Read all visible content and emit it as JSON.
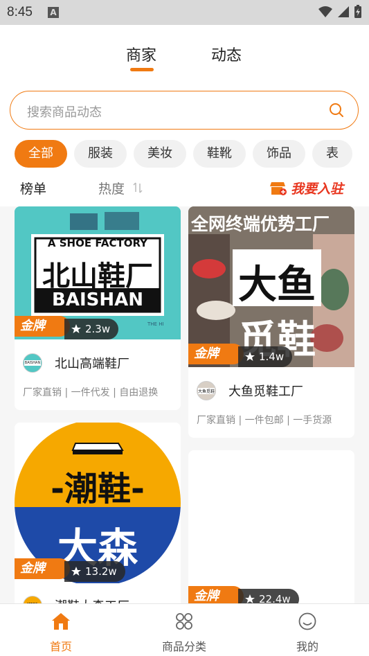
{
  "status": {
    "time": "8:45",
    "notif_icon": "A"
  },
  "tabs": [
    {
      "label": "商家",
      "active": true
    },
    {
      "label": "动态",
      "active": false
    }
  ],
  "search": {
    "placeholder": "搜索商品动态"
  },
  "categories": [
    "全部",
    "服装",
    "美妆",
    "鞋靴",
    "饰品",
    "表"
  ],
  "sort": {
    "rank_label": "榜单",
    "hot_label": "热度",
    "join_label": "我要入驻"
  },
  "cards": [
    {
      "badge": "金牌",
      "heat": "2.3w",
      "name": "北山高端鞋厂",
      "tags": "厂家直销 | 一件代发 | 自由退换",
      "image": {
        "line1": "A SHOE FACTORY",
        "line2": "北山鞋厂",
        "line3": "BAISHAN",
        "corner": "THE HI"
      },
      "avatar_text": "BAISHAN"
    },
    {
      "badge": "金牌",
      "heat": "1.4w",
      "name": "大鱼觅鞋工厂",
      "tags": "厂家直销 | 一件包邮 | 一手货源",
      "image": {
        "banner": "全网终端优势工厂",
        "big1": "大鱼",
        "big2": "觅鞋"
      },
      "avatar_text": "大鱼觅鞋"
    },
    {
      "badge": "金牌",
      "heat": "13.2w",
      "name": "潮鞋大森工厂",
      "image": {
        "line1": "-潮鞋-",
        "line2": "大森"
      },
      "avatar_text": "潮鞋"
    },
    {
      "badge": "金牌",
      "heat": "22.4w"
    }
  ],
  "nav": [
    {
      "label": "首页",
      "active": true
    },
    {
      "label": "商品分类",
      "active": false
    },
    {
      "label": "我的",
      "active": false
    }
  ],
  "colors": {
    "accent": "#f07a12",
    "join_red": "#e8361f",
    "teal": "#52c7c4",
    "navy": "#1e4aa8",
    "yellow": "#f6a800"
  }
}
